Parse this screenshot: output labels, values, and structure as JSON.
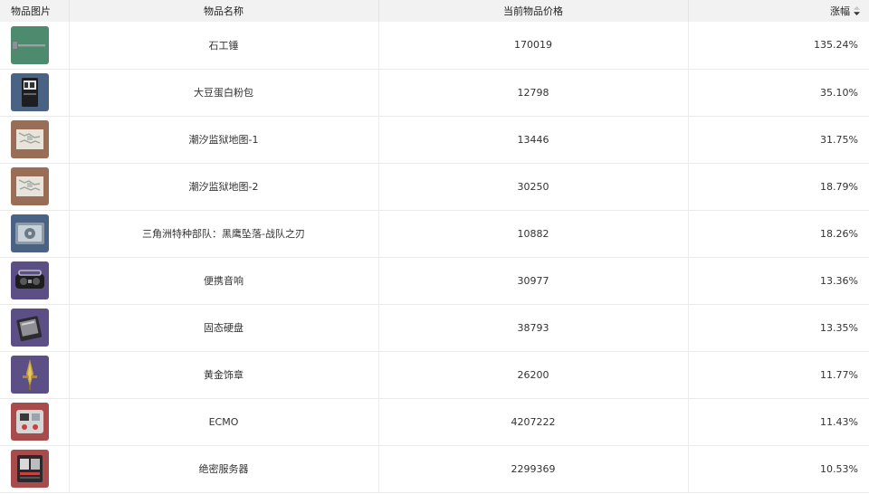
{
  "table": {
    "headers": {
      "image": "物品图片",
      "name": "物品名称",
      "price": "当前物品价格",
      "change": "涨幅"
    },
    "rows": [
      {
        "name": "石工锤",
        "price": "170019",
        "change": "135.24%",
        "thumb_color": "#4e8a6e",
        "icon": "sledgehammer-icon"
      },
      {
        "name": "大豆蛋白粉包",
        "price": "12798",
        "change": "35.10%",
        "thumb_color": "#4a6284",
        "icon": "protein-powder-bag-icon"
      },
      {
        "name": "潮汐监狱地图-1",
        "price": "13446",
        "change": "31.75%",
        "thumb_color": "#9a6e56",
        "icon": "prison-map-icon"
      },
      {
        "name": "潮汐监狱地图-2",
        "price": "30250",
        "change": "18.79%",
        "thumb_color": "#9a6e56",
        "icon": "prison-map-icon"
      },
      {
        "name": "三角洲特种部队：黑鹰坠落-战队之刃",
        "price": "10882",
        "change": "18.26%",
        "thumb_color": "#4a6284",
        "icon": "dvd-case-icon"
      },
      {
        "name": "便携音响",
        "price": "30977",
        "change": "13.36%",
        "thumb_color": "#5c4f86",
        "icon": "portable-speaker-icon"
      },
      {
        "name": "固态硬盘",
        "price": "38793",
        "change": "13.35%",
        "thumb_color": "#5c4f86",
        "icon": "ssd-icon"
      },
      {
        "name": "黄金饰章",
        "price": "26200",
        "change": "11.77%",
        "thumb_color": "#5c4f86",
        "icon": "gold-emblem-icon"
      },
      {
        "name": "ECMO",
        "price": "4207222",
        "change": "11.43%",
        "thumb_color": "#a84b4b",
        "icon": "ecmo-machine-icon"
      },
      {
        "name": "绝密服务器",
        "price": "2299369",
        "change": "10.53%",
        "thumb_color": "#a84b4b",
        "icon": "server-icon"
      }
    ]
  }
}
